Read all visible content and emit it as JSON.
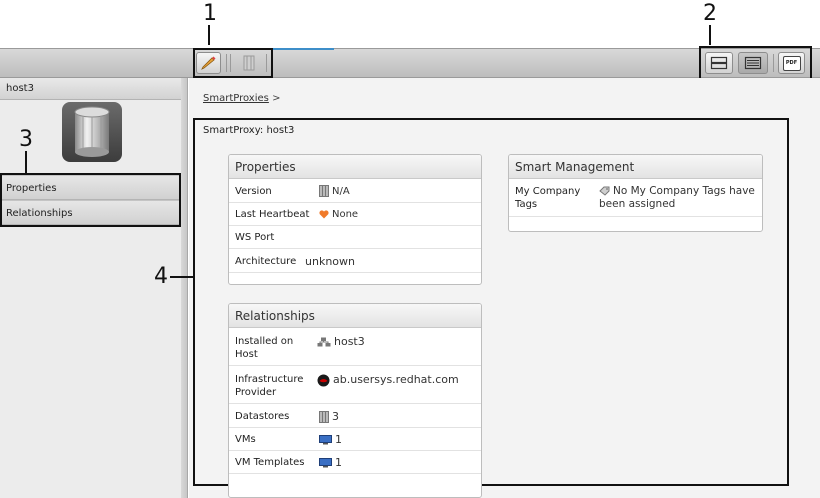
{
  "callouts": [
    "1",
    "2",
    "3",
    "4"
  ],
  "toolbar": {
    "left_buttons": [
      "edit-icon",
      "columns-icon"
    ],
    "right_buttons": [
      "grid-view-icon",
      "list-view-icon",
      "pdf-icon"
    ],
    "pdf_label": "PDF",
    "accent_color": "#3d8ec9"
  },
  "sidebar": {
    "title": "host3",
    "items": [
      {
        "label": "Properties"
      },
      {
        "label": "Relationships"
      }
    ]
  },
  "breadcrumb": {
    "link": "SmartProxies",
    "separator": ">"
  },
  "page_title": "SmartProxy: host3",
  "properties": {
    "title": "Properties",
    "rows": [
      {
        "label": "Version",
        "value": "N/A",
        "icon": "columns-icon"
      },
      {
        "label": "Last Heartbeat",
        "value": "None",
        "icon": "heart-icon"
      },
      {
        "label": "WS Port",
        "value": ""
      },
      {
        "label": "Architecture",
        "value": "unknown"
      }
    ]
  },
  "relationships": {
    "title": "Relationships",
    "rows": [
      {
        "label": "Installed on Host",
        "value": "host3",
        "icon": "host-icon"
      },
      {
        "label": "Infrastructure Provider",
        "value": "ab.usersys.redhat.com",
        "icon": "redhat-icon"
      },
      {
        "label": "Datastores",
        "value": "3",
        "icon": "datastore-icon"
      },
      {
        "label": "VMs",
        "value": "1",
        "icon": "vm-icon"
      },
      {
        "label": "VM Templates",
        "value": "1",
        "icon": "vm-icon"
      }
    ]
  },
  "smart_management": {
    "title": "Smart Management",
    "rows": [
      {
        "label": "My Company Tags",
        "value": "No My Company Tags have been assigned",
        "icon": "tag-icon"
      }
    ]
  }
}
